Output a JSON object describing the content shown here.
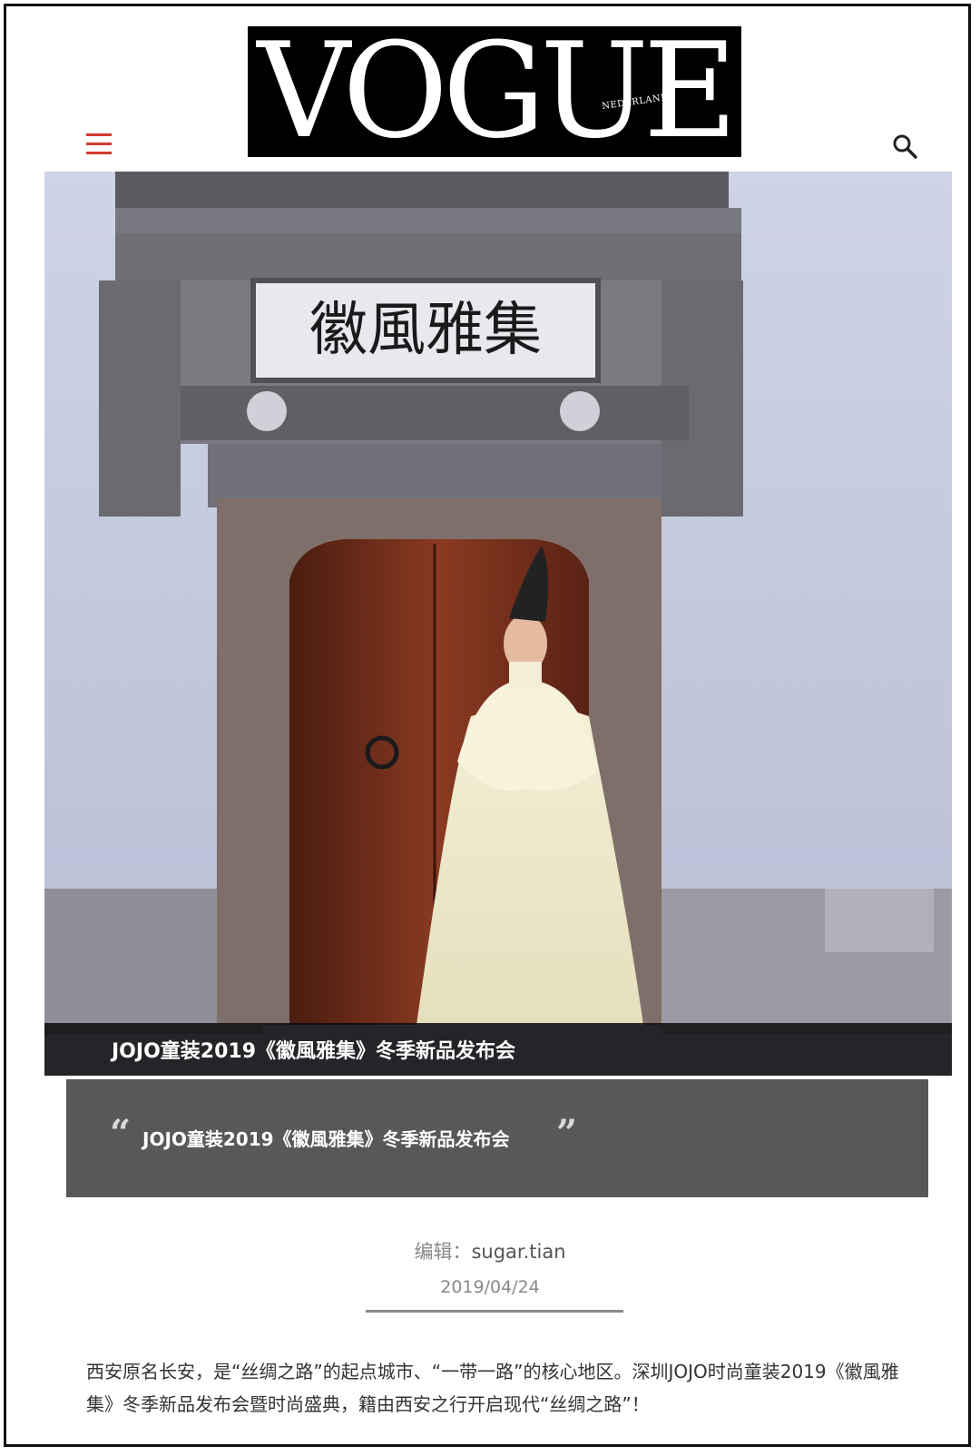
{
  "header": {
    "logo_text": "VOGUE",
    "logo_subtext": "NEDERLAND",
    "menu_icon": "hamburger-menu-icon",
    "search_icon": "search-icon",
    "accent_color": "#d23a2f"
  },
  "hero": {
    "sign_text": "徽風雅集",
    "caption": "JOJO童装2019《徽風雅集》冬季新品发布会"
  },
  "quote": {
    "open_mark": "“",
    "close_mark": "”",
    "text": "JOJO童装2019《徽風雅集》冬季新品发布会"
  },
  "meta": {
    "editor_label": "编辑：",
    "editor_name": "sugar.tian",
    "date": "2019/04/24"
  },
  "article": {
    "paragraph": "西安原名长安，是“丝绸之路”的起点城市、“一带一路”的核心地区。深圳JOJO时尚童装2019《徽風雅集》冬季新品发布会暨时尚盛典，籍由西安之行开启现代“丝绸之路”！"
  }
}
